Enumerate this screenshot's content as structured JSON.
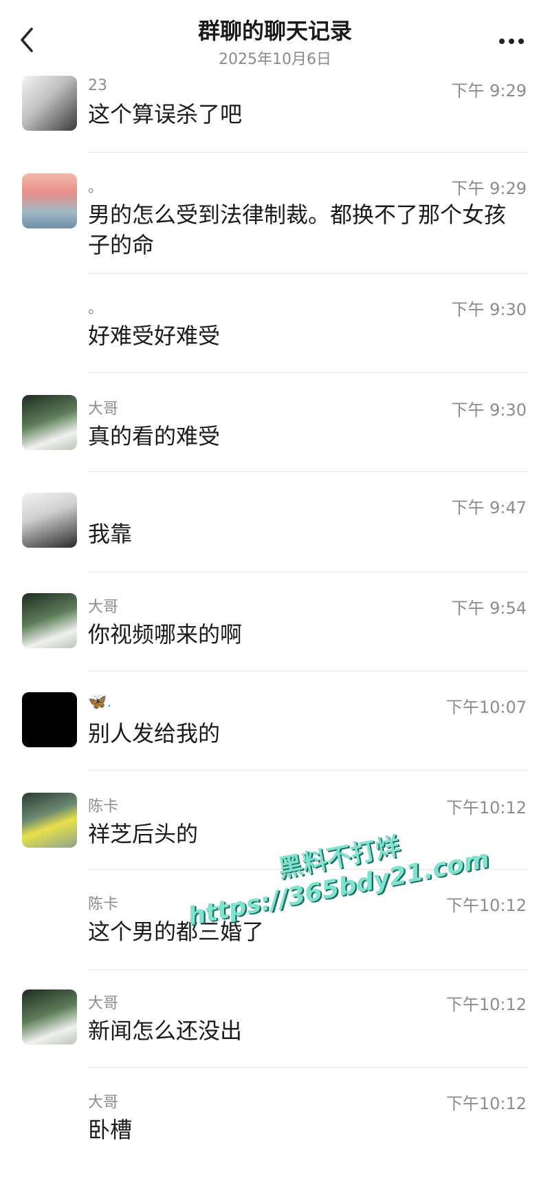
{
  "header": {
    "title": "群聊的聊天记录",
    "subtitle": "2025年10月6日",
    "back_icon": "chevron-left-icon",
    "more_icon": "more-horizontal-icon"
  },
  "messages": [
    {
      "sender": "23",
      "time": "下午 9:29",
      "text": "这个算误杀了吧",
      "avatar": "photo-avatar"
    },
    {
      "sender": "。",
      "time": "下午 9:29",
      "text": "男的怎么受到法律制裁。都换不了那个女孩子的命",
      "avatar": "photo-avatar"
    },
    {
      "sender": "。",
      "time": "下午 9:30",
      "text": "好难受好难受",
      "avatar": ""
    },
    {
      "sender": "大哥",
      "time": "下午 9:30",
      "text": "真的看的难受",
      "avatar": "photo-avatar"
    },
    {
      "sender": "",
      "time": "下午 9:47",
      "text": "我靠",
      "avatar": "photo-avatar"
    },
    {
      "sender": "大哥",
      "time": "下午 9:54",
      "text": "你视频哪来的啊",
      "avatar": "photo-avatar"
    },
    {
      "sender": "🦋.",
      "time": "下午10:07",
      "text": "别人发给我的",
      "avatar": "black-avatar"
    },
    {
      "sender": "陈卡",
      "time": "下午10:12",
      "text": "祥芝后头的",
      "avatar": "photo-avatar"
    },
    {
      "sender": "陈卡",
      "time": "下午10:12",
      "text": "这个男的都三婚了",
      "avatar": ""
    },
    {
      "sender": "大哥",
      "time": "下午10:12",
      "text": "新闻怎么还没出",
      "avatar": "photo-avatar"
    },
    {
      "sender": "大哥",
      "time": "下午10:12",
      "text": "卧槽",
      "avatar": ""
    }
  ],
  "watermark": {
    "line1": "黑料不打烊",
    "line2": "https://365bdy21.com"
  }
}
